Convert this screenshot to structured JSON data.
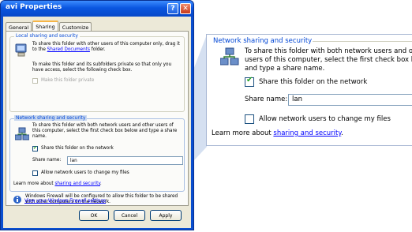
{
  "window": {
    "title": "avi Properties",
    "help_glyph": "?",
    "close_glyph": "✕"
  },
  "tabs": [
    {
      "label": "General",
      "active": false
    },
    {
      "label": "Sharing",
      "active": true
    },
    {
      "label": "Customize",
      "active": false
    }
  ],
  "local_sharing": {
    "legend": "Local sharing and security",
    "text_before_link": "To share this folder with other users of this computer only, drag it to the ",
    "link": "Shared Documents",
    "text_after_link": " folder.",
    "private_text": "To make this folder and its subfolders private so that only you have access, select the following check box.",
    "private_checkbox_label": "Make this folder private"
  },
  "network_sharing": {
    "legend": "Network sharing and security",
    "description": "To share this folder with both network users and other users of this computer, select the first check box below and type a share name.",
    "share_checkbox_label": "Share this folder on the network",
    "share_checked": true,
    "share_name_label": "Share name:",
    "share_name_value": "lan",
    "allow_change_label": "Allow network users to change my files",
    "allow_change_checked": false,
    "learn_more_prefix": "Learn more about ",
    "learn_more_link": "sharing and security",
    "learn_more_suffix": "."
  },
  "firewall": {
    "text": "Windows Firewall will be configured to allow this folder to be shared with other computers on the network.",
    "link": "View your Windows Firewall settings"
  },
  "buttons": {
    "ok": "OK",
    "cancel": "Cancel",
    "apply": "Apply"
  },
  "zoom": {
    "legend": "Network sharing and security",
    "line1": "To share this folder with both network users and othe",
    "line2": "users of this computer, select the first check box belo",
    "line3": "and type a share name.",
    "share_checkbox_label": "Share this folder on the network",
    "share_name_label": "Share name:",
    "share_name_value": "lan",
    "allow_change_label": "Allow network users to change my files",
    "learn_more_prefix": "Learn more about ",
    "learn_more_link": "sharing and security",
    "learn_more_suffix": "."
  }
}
